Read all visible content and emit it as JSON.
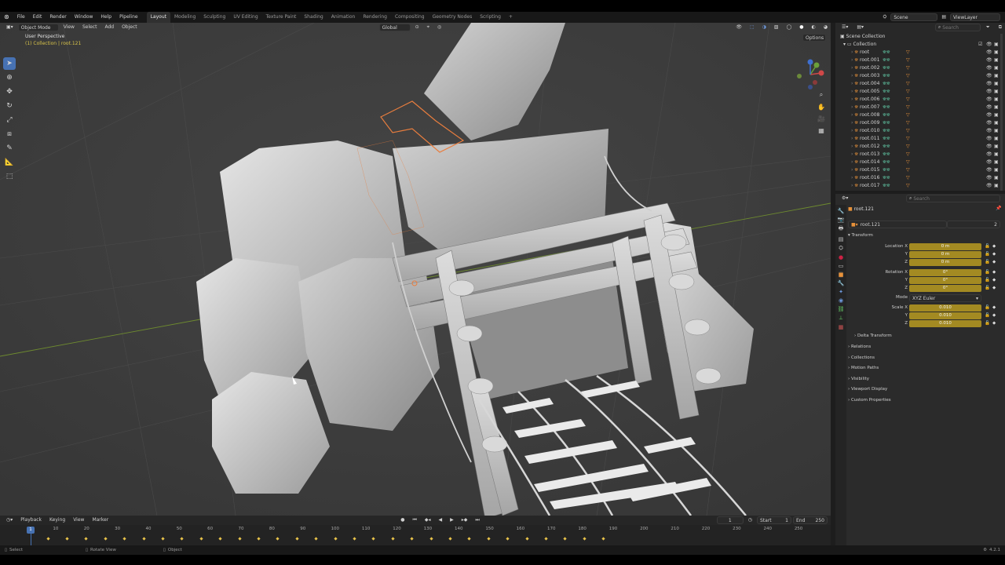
{
  "topbar": {
    "menus": [
      "File",
      "Edit",
      "Render",
      "Window",
      "Help",
      "Pipeline"
    ],
    "workspaces": [
      "Layout",
      "Modeling",
      "Sculpting",
      "UV Editing",
      "Texture Paint",
      "Shading",
      "Animation",
      "Rendering",
      "Compositing",
      "Geometry Nodes",
      "Scripting"
    ],
    "active_workspace": "Layout",
    "scene": "Scene",
    "view_layer": "ViewLayer"
  },
  "viewport": {
    "mode": "Object Mode",
    "menus": [
      "View",
      "Select",
      "Add",
      "Object"
    ],
    "orientation": "Global",
    "options_label": "Options",
    "overlay_title": "User Perspective",
    "overlay_subtitle": "(1) Collection | root.121"
  },
  "outliner": {
    "search_placeholder": "Search",
    "scene_collection": "Scene Collection",
    "collection": "Collection",
    "items": [
      "root",
      "root.001",
      "root.002",
      "root.003",
      "root.004",
      "root.005",
      "root.006",
      "root.007",
      "root.008",
      "root.009",
      "root.010",
      "root.011",
      "root.012",
      "root.013",
      "root.014",
      "root.015",
      "root.016",
      "root.017"
    ]
  },
  "properties": {
    "search_placeholder": "Search",
    "object_header": "root.121",
    "object_name": "root.121",
    "user_count": "2",
    "transform_label": "Transform",
    "location": {
      "label": "Location X",
      "y": "Y",
      "z": "Z",
      "values": [
        "0 m",
        "0 m",
        "0 m"
      ]
    },
    "rotation": {
      "label": "Rotation X",
      "y": "Y",
      "z": "Z",
      "values": [
        "0°",
        "0°",
        "0°"
      ]
    },
    "mode_label": "Mode",
    "mode_value": "XYZ Euler",
    "scale": {
      "label": "Scale X",
      "y": "Y",
      "z": "Z",
      "values": [
        "0.010",
        "0.010",
        "0.010"
      ]
    },
    "delta_transform": "Delta Transform",
    "sections": [
      "Relations",
      "Collections",
      "Motion Paths",
      "Visibility",
      "Viewport Display",
      "Custom Properties"
    ]
  },
  "timeline": {
    "menus": [
      "Playback",
      "Keying",
      "View",
      "Marker"
    ],
    "current_frame": "1",
    "start_label": "Start",
    "start": "1",
    "end_label": "End",
    "end": "250",
    "ruler": [
      "10",
      "20",
      "30",
      "40",
      "50",
      "60",
      "70",
      "80",
      "90",
      "100",
      "110",
      "120",
      "130",
      "140",
      "150",
      "160",
      "170",
      "180",
      "190",
      "200",
      "210",
      "220",
      "230",
      "240",
      "250"
    ],
    "playhead": "1"
  },
  "statusbar": {
    "select": "Select",
    "rotate": "Rotate View",
    "object": "Object",
    "version": "4.2.1"
  },
  "colors": {
    "accent": "#4772b3",
    "selected_field": "#a38a22",
    "viewport_bg": "#3d3d3d",
    "orange": "#e87d3e"
  }
}
